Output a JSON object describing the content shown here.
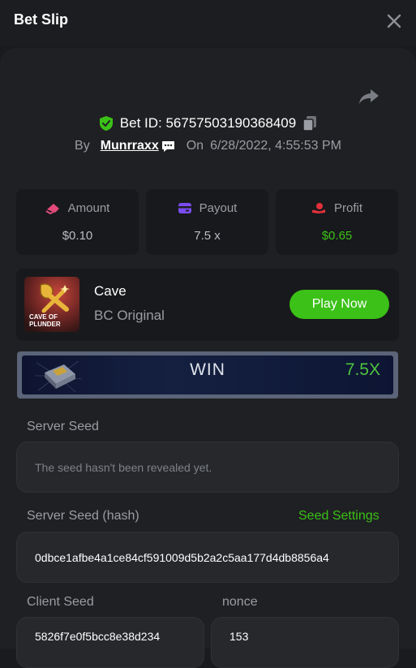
{
  "header": {
    "title": "Bet Slip"
  },
  "bet": {
    "id_label": "Bet ID: 5675750319036840​9",
    "by_label": "By",
    "user": "Munrraxx",
    "on_label": "On",
    "date": "6/28/2022, 4:55:53 PM"
  },
  "stats": {
    "amount": {
      "label": "Amount",
      "value": "$0.10"
    },
    "payout": {
      "label": "Payout",
      "value": "7.5 x"
    },
    "profit": {
      "label": "Profit",
      "value": "$0.65"
    }
  },
  "game": {
    "name": "Cave",
    "subtitle": "BC Original",
    "play_label": "Play Now",
    "thumb_text_1": "CAVE OF",
    "thumb_text_2": "PLUNDER"
  },
  "result": {
    "status": "WIN",
    "multiplier": "7.5X"
  },
  "seeds": {
    "server_seed_label": "Server Seed",
    "server_seed_value": "The seed hasn't been revealed yet.",
    "server_hash_label": "Server Seed (hash)",
    "seed_settings_label": "Seed Settings",
    "server_hash_value": "0dbce1afbe4a1ce84cf591009d5b2a2c5aa177d4db8856a4",
    "client_seed_label": "Client Seed",
    "client_seed_value": "5826f7e0f5bcc8e38d234",
    "nonce_label": "nonce",
    "nonce_value": "153"
  },
  "colors": {
    "accent": "#3bc117",
    "shield": "#3bc117",
    "amount_icon": "#e24a79",
    "payout_icon": "#7a4bf0",
    "profit_icon": "#e0303a"
  },
  "icons": [
    "close-icon",
    "share-icon",
    "shield-check-icon",
    "copy-icon",
    "chat-icon",
    "amount-icon",
    "payout-icon",
    "profit-icon",
    "treasure-box-icon"
  ]
}
